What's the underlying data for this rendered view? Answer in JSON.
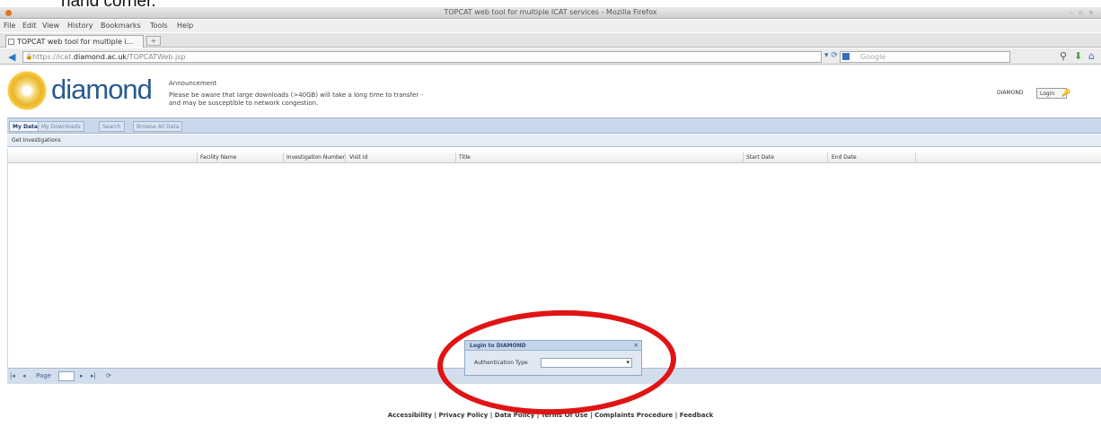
{
  "caption": "hand corner.",
  "window": {
    "title": "TOPCAT web tool for multiple ICAT services - Mozilla Firefox",
    "controls": "– ▫ ×"
  },
  "menu": [
    "File",
    "Edit",
    "View",
    "History",
    "Bookmarks",
    "Tools",
    "Help"
  ],
  "browser_tab": {
    "label": "TOPCAT web tool for multiple i...",
    "new_tab": "+"
  },
  "address_bar": {
    "prefix": "https://icat.",
    "host": "diamond.ac.uk",
    "path": "/TOPCATWeb.jsp",
    "search_placeholder": "Google"
  },
  "header": {
    "logo_text": "diamond",
    "announcement_title": "Announcement",
    "announcement_text": "Please be aware that large downloads (>40GB) will take a long time to transfer - and may be susceptible to network congestion.",
    "facility": "DIAMOND",
    "login_label": "Login"
  },
  "nav_tabs": [
    "My Data",
    "My Downloads",
    "Search",
    "Browse All Data"
  ],
  "sub_action": "Get Investigations",
  "grid": {
    "columns": [
      "Facility Name",
      "Investigation Number",
      "Visit Id",
      "Title",
      "Start Date",
      "End Date"
    ]
  },
  "pager": {
    "first": "|◂",
    "prev": "◂",
    "page_label": "Page",
    "next": "▸",
    "last": "▸|",
    "refresh": "⟳"
  },
  "footer": "Accessibility | Privacy Policy | Data Policy | Terms Of Use | Complaints Procedure | Feedback",
  "login_dialog": {
    "title": "Login to DIAMOND",
    "close": "×",
    "auth_label": "Authentication Type",
    "auth_value": ""
  },
  "colors": {
    "annotation_circle": "#e01414",
    "logo_blue": "#2a5b8f",
    "nav_bar": "#c9d7ea"
  },
  "icons": [
    "firefox-app-icon",
    "back-arrow-icon",
    "lock-icon",
    "reload-icon",
    "search-engine-icon",
    "binoculars-icon",
    "download-arrow-icon",
    "home-icon",
    "diamond-sun-logo-icon",
    "key-icon",
    "refresh-icon"
  ]
}
